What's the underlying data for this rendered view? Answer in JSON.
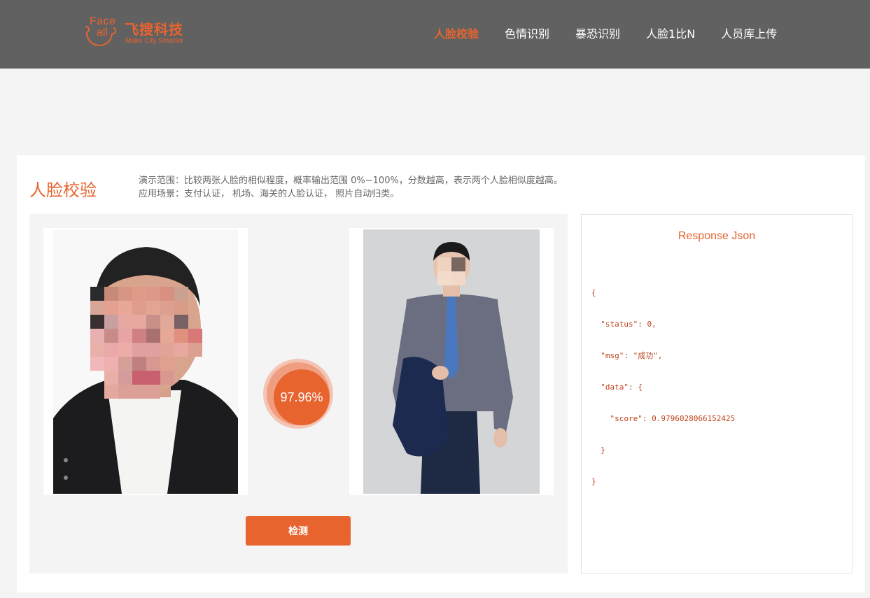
{
  "brand": {
    "logo_face": "Face",
    "logo_all": "all",
    "name_cn": "飞搜科技",
    "tagline": "Make City Smarter"
  },
  "nav": {
    "items": [
      {
        "label": "人脸校验",
        "active": true
      },
      {
        "label": "色情识别",
        "active": false
      },
      {
        "label": "暴恐识别",
        "active": false
      },
      {
        "label": "人脸1比N",
        "active": false
      },
      {
        "label": "人员库上传",
        "active": false
      }
    ]
  },
  "card": {
    "title": "人脸校验",
    "desc_line1": "演示范围：比较两张人脸的相似程度，概率输出范围 0%~100%，分数越高，表示两个人脸相似度越高。",
    "desc_line2": "应用场景：支付认证， 机场、海关的人脸认证， 照片自动归类。"
  },
  "compare": {
    "score_text": "97.96%",
    "detect_label": "检测"
  },
  "response": {
    "title": "Response Json",
    "json_lines": [
      "{",
      "  \"status\": 0,",
      "  \"msg\": \"成功\",",
      "  \"data\": {",
      "    \"score\": 0.9796028066152425",
      "  }",
      "}"
    ]
  },
  "colors": {
    "accent": "#e8642f",
    "header_bg": "#616161",
    "page_bg": "#f4f4f4"
  }
}
